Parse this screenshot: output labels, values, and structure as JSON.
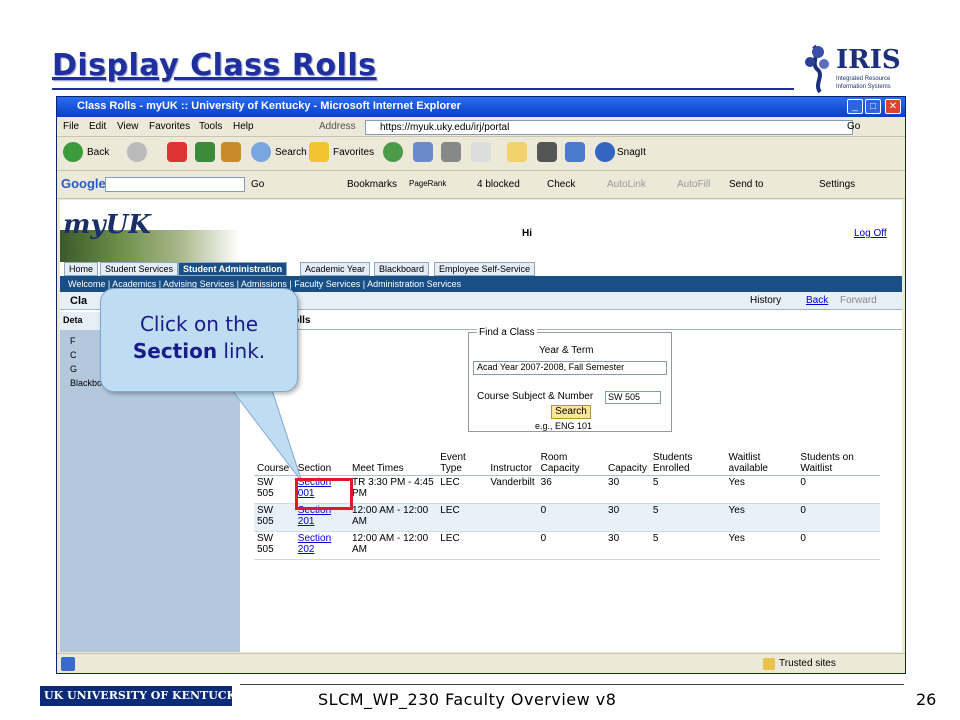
{
  "slide": {
    "title": "Display Class Rolls",
    "footer": "SLCM_WP_230 Faculty Overview v8",
    "page_number": "26",
    "logo_text": "IRIS",
    "logo_subtitle": "Integrated Resource Information Systems",
    "uk_logo_text": "UK UNIVERSITY OF KENTUCKY"
  },
  "browser": {
    "title": "Class Rolls - myUK :: University of Kentucky - Microsoft Internet Explorer",
    "menu": [
      "File",
      "Edit",
      "View",
      "Favorites",
      "Tools",
      "Help"
    ],
    "address_label": "Address",
    "address": "https://myuk.uky.edu/irj/portal",
    "go_label": "Go",
    "toolbar": [
      "Back",
      "Search",
      "Favorites",
      "SnagIt"
    ],
    "google_bar": [
      "Google",
      "Go",
      "Bookmarks",
      "PageRank",
      "4 blocked",
      "Check",
      "AutoLink",
      "AutoFill",
      "Send to",
      "Settings"
    ],
    "status_zone": "Trusted sites"
  },
  "portal": {
    "logo": "myUK",
    "greeting": "Hi",
    "logoff": "Log Off",
    "tabs": [
      "Home",
      "Student Services",
      "Student Administration",
      "Academic Year",
      "Blackboard",
      "Employee Self-Service"
    ],
    "subnav": "Welcome  |  Academics  |  Advising Services  |  Admissions  |  Faculty Services  |  Administration Services",
    "page_title": "Cla",
    "history": "History",
    "back": "Back",
    "forward": "Forward",
    "left_head": "Deta",
    "left_items": [
      "F",
      "C",
      "G",
      "Blackboard"
    ],
    "main_title": "Rolls"
  },
  "find_class": {
    "legend": "Find a Class",
    "year_term_label": "Year & Term",
    "year_term_value": "Acad Year 2007-2008, Fall Semester",
    "course_label": "Course Subject & Number",
    "course_value": "SW 505",
    "search_label": "Search",
    "example": "e.g., ENG 101"
  },
  "table": {
    "headers": [
      "Course",
      "Section",
      "Meet Times",
      "Event Type",
      "Instructor",
      "Room Capacity",
      "Capacity",
      "Students Enrolled",
      "Waitlist available",
      "Students on Waitlist"
    ],
    "rows": [
      [
        "SW 505",
        "Section 001",
        "TR 3:30 PM - 4:45 PM",
        "LEC",
        "Vanderbilt",
        "36",
        "30",
        "5",
        "Yes",
        "0"
      ],
      [
        "SW 505",
        "Section 201",
        "12:00 AM - 12:00 AM",
        "LEC",
        "",
        "0",
        "30",
        "5",
        "Yes",
        "0"
      ],
      [
        "SW 505",
        "Section 202",
        "12:00 AM - 12:00 AM",
        "LEC",
        "",
        "0",
        "30",
        "5",
        "Yes",
        "0"
      ]
    ]
  },
  "callout": {
    "line1": "Click on the",
    "bold": "Section",
    "line2_rest": " link."
  }
}
